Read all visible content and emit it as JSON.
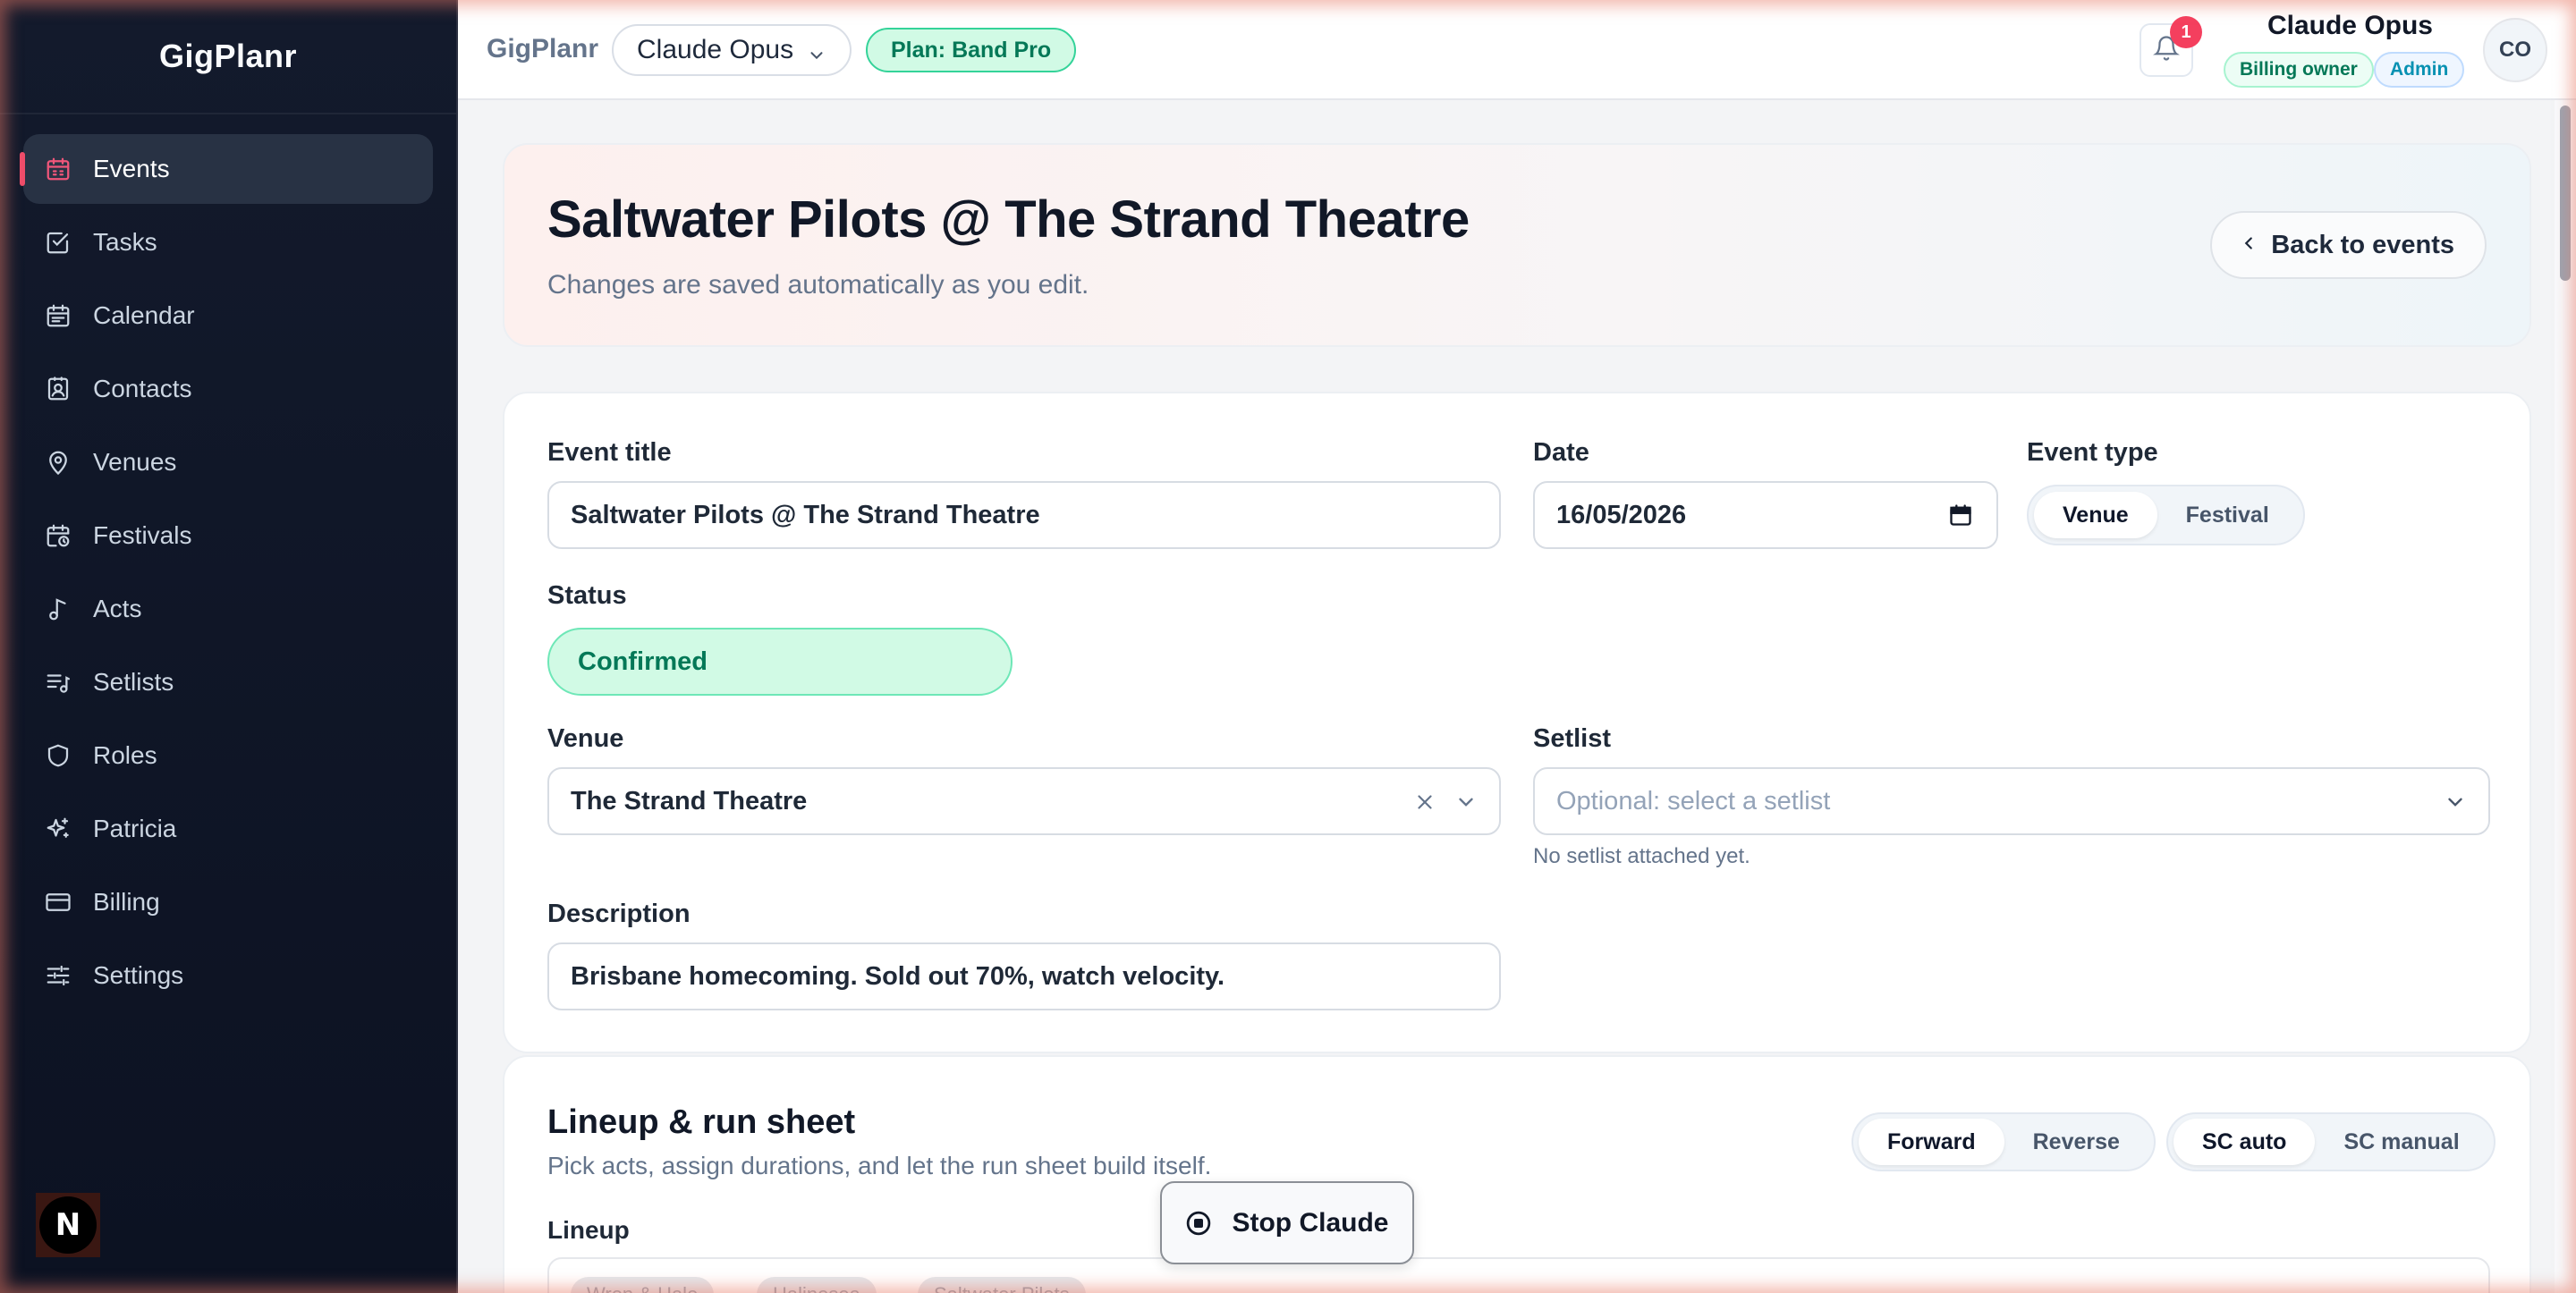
{
  "sidebar": {
    "brand": "GigPlanr",
    "items": [
      {
        "label": "Events",
        "icon": "calendar-icon",
        "active": true
      },
      {
        "label": "Tasks",
        "icon": "checkbox-icon"
      },
      {
        "label": "Calendar",
        "icon": "calendar-grid-icon"
      },
      {
        "label": "Contacts",
        "icon": "contact-card-icon"
      },
      {
        "label": "Venues",
        "icon": "map-pin-icon"
      },
      {
        "label": "Festivals",
        "icon": "calendar-clock-icon"
      },
      {
        "label": "Acts",
        "icon": "music-note-icon"
      },
      {
        "label": "Setlists",
        "icon": "list-music-icon"
      },
      {
        "label": "Roles",
        "icon": "shield-icon"
      },
      {
        "label": "Patricia",
        "icon": "sparkles-icon"
      },
      {
        "label": "Billing",
        "icon": "credit-card-icon"
      },
      {
        "label": "Settings",
        "icon": "sliders-icon"
      }
    ],
    "footer_logo": "N"
  },
  "topbar": {
    "brand": "GigPlanr",
    "workspace": "Claude Opus",
    "plan": "Plan: Band Pro",
    "notifications": "1",
    "user_name": "Claude Opus",
    "role_billing": "Billing owner",
    "role_admin": "Admin",
    "avatar": "CO"
  },
  "header": {
    "title": "Saltwater Pilots @ The Strand Theatre",
    "subtitle": "Changes are saved automatically as you edit.",
    "back_label": "Back to events"
  },
  "form": {
    "title_label": "Event title",
    "title_value": "Saltwater Pilots @ The Strand Theatre",
    "date_label": "Date",
    "date_value": "16/05/2026",
    "type_label": "Event type",
    "type_options": [
      "Venue",
      "Festival"
    ],
    "type_selected": "Venue",
    "status_label": "Status",
    "status_value": "Confirmed",
    "venue_label": "Venue",
    "venue_value": "The Strand Theatre",
    "setlist_label": "Setlist",
    "setlist_placeholder": "Optional: select a setlist",
    "setlist_hint": "No setlist attached yet.",
    "description_label": "Description",
    "description_value": "Brisbane homecoming. Sold out 70%, watch velocity."
  },
  "lineup": {
    "title": "Lineup & run sheet",
    "subtitle": "Pick acts, assign durations, and let the run sheet build itself.",
    "direction_options": [
      "Forward",
      "Reverse"
    ],
    "direction_selected": "Forward",
    "sc_options": [
      "SC auto",
      "SC manual"
    ],
    "sc_selected": "SC auto",
    "lineup_label": "Lineup",
    "chips": [
      "Wren & Hale",
      "Halinesea",
      "Saltwater Pilots"
    ]
  },
  "stop_button": "Stop Claude",
  "colors": {
    "sidebar_bg": "#0f1628",
    "accent": "#ef4d6a",
    "status_green": "#047857",
    "plan_green": "#d1fae5"
  }
}
